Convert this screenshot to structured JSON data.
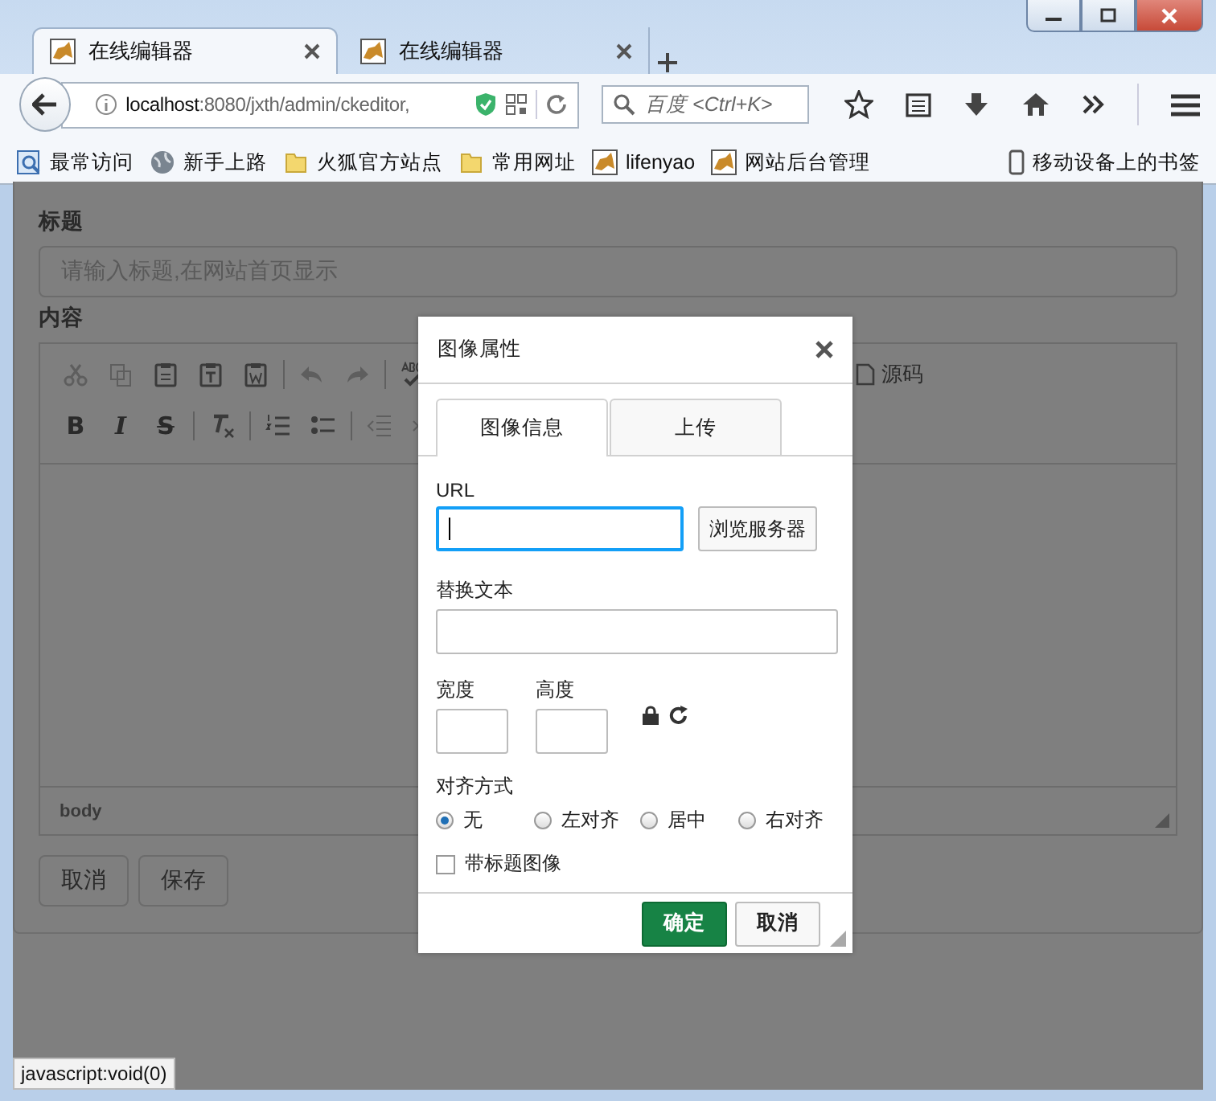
{
  "browser": {
    "tabs": [
      {
        "title": "在线编辑器",
        "selected": true
      },
      {
        "title": "在线编辑器",
        "selected": false
      }
    ],
    "address": {
      "host": "localhost",
      "path": ":8080/jxth/admin/ckeditor,"
    },
    "search": {
      "placeholder": "百度 <Ctrl+K>"
    },
    "bookmarks": [
      {
        "label": "最常访问",
        "kind": "recent"
      },
      {
        "label": "新手上路",
        "kind": "globe"
      },
      {
        "label": "火狐官方站点",
        "kind": "folder"
      },
      {
        "label": "常用网址",
        "kind": "folder"
      },
      {
        "label": "lifenyao",
        "kind": "site"
      },
      {
        "label": "网站后台管理",
        "kind": "site"
      }
    ],
    "mobile_bookmarks": "移动设备上的书签"
  },
  "form": {
    "title_label": "标题",
    "title_placeholder": "请输入标题,在网站首页显示",
    "content_label": "内容",
    "source_button": "源码",
    "format_buttons": [
      "B",
      "I",
      "S"
    ],
    "element_path": "body",
    "buttons": [
      "取消",
      "保存"
    ]
  },
  "dialog": {
    "title": "图像属性",
    "tabs": [
      {
        "label": "图像信息",
        "selected": true
      },
      {
        "label": "上传",
        "selected": false
      }
    ],
    "url_label": "URL",
    "browse_button": "浏览服务器",
    "alt_label": "替换文本",
    "width_label": "宽度",
    "height_label": "高度",
    "align_label": "对齐方式",
    "align_options": [
      {
        "label": "无",
        "selected": true
      },
      {
        "label": "左对齐",
        "selected": false
      },
      {
        "label": "居中",
        "selected": false
      },
      {
        "label": "右对齐",
        "selected": false
      }
    ],
    "caption": {
      "label": "带标题图像",
      "checked": false
    },
    "ok_button": "确定",
    "cancel_button": "取消"
  },
  "status_text": "javascript:void(0)"
}
